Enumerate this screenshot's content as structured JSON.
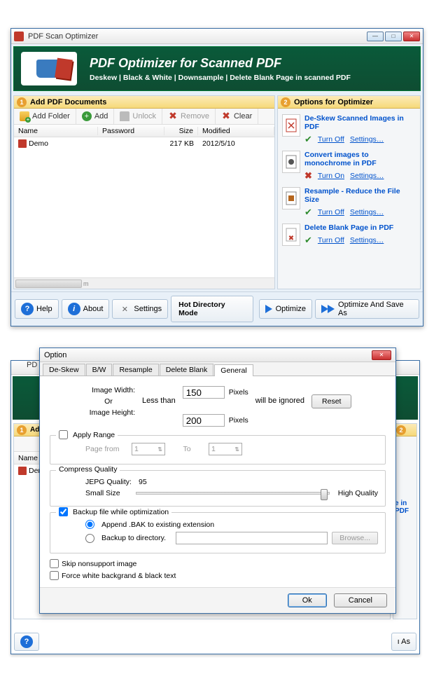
{
  "win1": {
    "title": "PDF Scan Optimizer",
    "banner_h1": "PDF Optimizer for Scanned PDF",
    "banner_sub": "Deskew | Black & White | Downsample | Delete Blank Page in scanned PDF",
    "sect1": "Add PDF Documents",
    "sect2": "Options for Optimizer",
    "tbar": {
      "addFolder": "Add Folder",
      "add": "Add",
      "unlock": "Unlock",
      "remove": "Remove",
      "clear": "Clear"
    },
    "cols": {
      "name": "Name",
      "password": "Password",
      "size": "Size",
      "modified": "Modified"
    },
    "row": {
      "name": "Demo",
      "size": "217 KB",
      "modified": "2012/5/10"
    },
    "opts": [
      {
        "title": "De-Skew Scanned Images in PDF",
        "on": true,
        "toggle": "Turn Off",
        "settings": "Settings…"
      },
      {
        "title": "Convert images to monochrome in PDF",
        "on": false,
        "toggle": "Turn On",
        "settings": "Settings…"
      },
      {
        "title": "Resample - Reduce the File Size",
        "on": true,
        "toggle": "Turn Off",
        "settings": "Settings…"
      },
      {
        "title": "Delete Blank Page in PDF",
        "on": true,
        "toggle": "Turn Off",
        "settings": "Settings…"
      }
    ],
    "footer": {
      "help": "Help",
      "about": "About",
      "settings": "Settings",
      "hotdir": "Hot Directory Mode",
      "optimize": "Optimize",
      "optsave": "Optimize And Save As"
    }
  },
  "ghost": {
    "title_prefix": "PD",
    "sect1_prefix": "Ad",
    "row_prefix": "Demo",
    "cols_name": "Name",
    "opt_tail": "e in PDF",
    "saveas_tail": "ı As"
  },
  "dlg": {
    "title": "Option",
    "tabs": [
      "De-Skew",
      "B/W",
      "Resample",
      "Delete Blank",
      "General"
    ],
    "activeTab": 4,
    "imgWidthLbl": "Image Width:",
    "orLbl": "Or",
    "lessLbl": "Less than",
    "imgHeightLbl": "Image Height:",
    "ignoredLbl": "will be ignored",
    "pixels": "Pixels",
    "imgWidth": "150",
    "imgHeight": "200",
    "reset": "Reset",
    "applyRange": "Apply Range",
    "pageFrom": "Page from",
    "pageFromVal": "1",
    "to": "To",
    "toVal": "1",
    "compressQ": "Compress Quality",
    "jpegQ": "JEPG Quality:",
    "jpegVal": "95",
    "smallSize": "Small Size",
    "highQ": "High Quality",
    "backupChk": "Backup file while optimization",
    "appendBak": "Append .BAK to existing  extension",
    "backupDir": "Backup to directory.",
    "browse": "Browse...",
    "skip": "Skip nonsupport image",
    "forceWhite": "Force white backgrand & black text",
    "ok": "Ok",
    "cancel": "Cancel"
  }
}
